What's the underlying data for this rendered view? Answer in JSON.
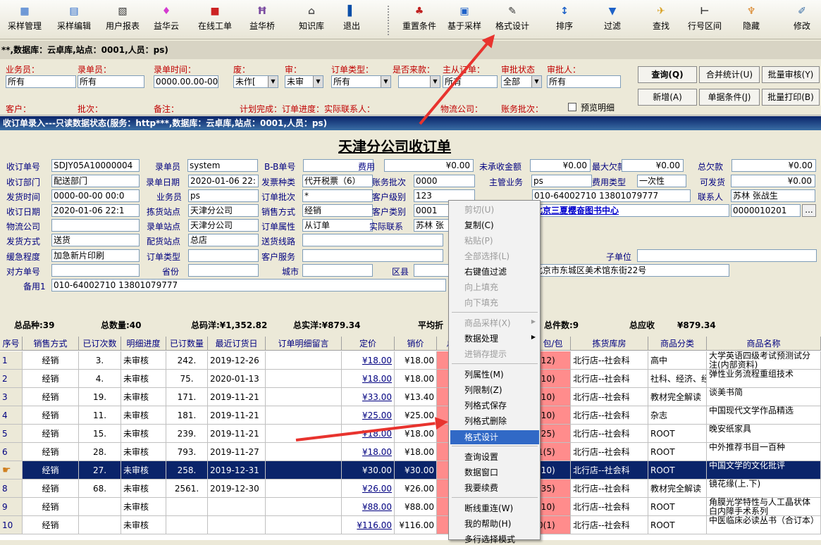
{
  "toolbar": [
    {
      "label": "采样管理",
      "icon": "grid-icon",
      "color": "#1e62c8"
    },
    {
      "label": "采样编辑",
      "icon": "grid-edit-icon",
      "color": "#1e62c8"
    },
    {
      "label": "用户报表",
      "icon": "report-icon",
      "color": "#333333"
    },
    {
      "label": "益华云",
      "icon": "cloud-app-icon",
      "color": "#d43bd0"
    },
    {
      "label": "在线工单",
      "icon": "online-ticket-icon",
      "color": "#cc2222"
    },
    {
      "label": "益华桥",
      "icon": "bridge-icon",
      "color": "#7a4aa0"
    },
    {
      "label": "知识库",
      "icon": "library-icon",
      "color": "#555555"
    },
    {
      "label": "退出",
      "icon": "exit-icon",
      "color": "#0a4ea8"
    },
    {
      "label": "重置条件",
      "icon": "reset-icon",
      "color": "#c02020"
    },
    {
      "label": "基于采样",
      "icon": "sample-icon",
      "color": "#1e62c8"
    },
    {
      "label": "格式设计",
      "icon": "format-design-icon",
      "color": "#333333"
    },
    {
      "label": "排序",
      "icon": "sort-icon",
      "color": "#1e62c8"
    },
    {
      "label": "过滤",
      "icon": "filter-icon",
      "color": "#1e62c8"
    },
    {
      "label": "查找",
      "icon": "find-icon",
      "color": "#d8a020"
    },
    {
      "label": "行号区间",
      "icon": "row-range-icon",
      "color": "#333333"
    },
    {
      "label": "隐藏",
      "icon": "hide-icon",
      "color": "#d88020"
    },
    {
      "label": "修改",
      "icon": "edit-icon",
      "color": "#3a6ea5"
    }
  ],
  "infobar": "**,数据库：云卓库,站点：0001,人员：ps)",
  "query": {
    "labels": [
      "业务员：",
      "录单员：",
      "录单时间：",
      "废：",
      "审：",
      "订单类型：",
      "是否来款：",
      "主从订单：",
      "审批状态",
      "审批人："
    ],
    "labels2": [
      "客户：",
      "批次：",
      "备注：",
      "计划完成：订单进度：实际联系人：",
      "物流公司：",
      "账务批次：",
      "预览明细"
    ],
    "inputs": {
      "salesman": "所有",
      "clerk": "所有",
      "time": "0000.00.00-00",
      "void": "未作[",
      "audit": "未审",
      "order_type": "所有",
      "has_payment": "",
      "master_slave": "所有",
      "approval": "全部",
      "approver": "所有"
    },
    "buttons": [
      "查询(Q)",
      "合并统计(U)",
      "批量审核(Y)",
      "新增(A)",
      "单据条件(J)",
      "批量打印(B)"
    ]
  },
  "form_title": "收订单录入---只读数据状态(服务：http***,数据库：云卓库,站点：0001,人员：ps)",
  "form": {
    "heading": "天津分公司收订单",
    "fields": [
      {
        "label": "收订单号",
        "value": "SDJY05A10000004"
      },
      {
        "label": "录单员",
        "value": "system"
      },
      {
        "label": "B-B单号",
        "value": ""
      },
      {
        "label": "费用",
        "value": "¥0.00"
      },
      {
        "label": "未承收金额",
        "value": "¥0.00"
      },
      {
        "label": "最大欠款",
        "value": "¥0.00"
      },
      {
        "label": "总欠款",
        "value": "¥0.00"
      },
      {
        "label": "收订部门",
        "value": "配送部门"
      },
      {
        "label": "录单日期",
        "value": "2020-01-06 22:"
      },
      {
        "label": "发票种类",
        "value": "代开税票（6）"
      },
      {
        "label": "账务批次",
        "value": "0000"
      },
      {
        "label": "主管业务",
        "value": "ps"
      },
      {
        "label": "费用类型",
        "value": "一次性"
      },
      {
        "label": "可发货",
        "value": "¥0.00"
      },
      {
        "label": "发货时间",
        "value": "0000-00-00 00:0"
      },
      {
        "label": "业务员",
        "value": "ps"
      },
      {
        "label": "订单批次",
        "value": "*"
      },
      {
        "label": "客户级别",
        "value": "123"
      },
      {
        "label": "电话",
        "value": "010-64002710  13801079777"
      },
      {
        "label": "联系人",
        "value": "苏林  张战生"
      },
      {
        "label": "收订日期",
        "value": "2020-01-06 22:1"
      },
      {
        "label": "拣货站点",
        "value": "天津分公司"
      },
      {
        "label": "销售方式",
        "value": "经销"
      },
      {
        "label": "客户类别",
        "value": "0001"
      },
      {
        "label": "客户",
        "value": "北京三夏樱奋图书中心"
      },
      {
        "label": "客户编号",
        "value": "0000010201"
      },
      {
        "label": "物流公司",
        "value": ""
      },
      {
        "label": "录单站点",
        "value": "天津分公司"
      },
      {
        "label": "订单属性",
        "value": "从订单"
      },
      {
        "label": "实际联系",
        "value": "苏林  张"
      },
      {
        "label": "发货方式",
        "value": "送货"
      },
      {
        "label": "配货站点",
        "value": "总店"
      },
      {
        "label": "送货线路",
        "value": ""
      },
      {
        "label": "缓急程度",
        "value": "加急新片印刷"
      },
      {
        "label": "订单类型",
        "value": ""
      },
      {
        "label": "客户服务",
        "value": ""
      },
      {
        "label": "子单位",
        "value": ""
      },
      {
        "label": "对方单号",
        "value": ""
      },
      {
        "label": "省份",
        "value": ""
      },
      {
        "label": "城市",
        "value": ""
      },
      {
        "label": "区县",
        "value": ""
      },
      {
        "label": "地址",
        "value": "北京市东城区美术馆东街22号"
      },
      {
        "label": "备用1",
        "value": "010-64002710  13801079777"
      }
    ]
  },
  "summary": {
    "kinds": "总品种:39",
    "qty": "总数量:40",
    "list_price": "总码洋:¥1,352.82",
    "actual_price": "总实洋:¥879.34",
    "avg_discount": "平均折",
    "packages": "总件数:9",
    "receivable": "总应收",
    "receivable_value": "¥879.34"
  },
  "grid": {
    "headers": [
      "序号",
      "销售方式",
      "已订次数",
      "明细进度",
      "已订数量",
      "最近订货日",
      "订单明细留言",
      "定价",
      "销价",
      "总",
      "包/包",
      "拣货库房",
      "商品分类",
      "商品名称"
    ],
    "rows": [
      {
        "no": "1",
        "method": "经销",
        "times": "3.",
        "progress": "未审核",
        "qty": "242.",
        "date": "2019-12-26",
        "note": "",
        "price": "¥18.00",
        "sale": "¥18.00",
        "pkg": "(12)",
        "store": "北行店--社会科",
        "cat": "高中",
        "name": "大学英语四级考试预测试分注(内部资料)"
      },
      {
        "no": "2",
        "method": "经销",
        "times": "4.",
        "progress": "未审核",
        "qty": "75.",
        "date": "2020-01-13",
        "note": "",
        "price": "¥18.00",
        "sale": "¥18.00",
        "pkg": "(10)",
        "store": "北行店--社会科",
        "cat": "社科、经济、经",
        "name": "弹性业务流程重组技术"
      },
      {
        "no": "3",
        "method": "经销",
        "times": "19.",
        "progress": "未审核",
        "qty": "171.",
        "date": "2019-11-21",
        "note": "",
        "price": "¥33.00",
        "sale": "¥13.40",
        "pkg": "(10)",
        "store": "北行店--社会科",
        "cat": "教材完全解读",
        "name": "谈美书简"
      },
      {
        "no": "4",
        "method": "经销",
        "times": "11.",
        "progress": "未审核",
        "qty": "181.",
        "date": "2019-11-21",
        "note": "",
        "price": "¥25.00",
        "sale": "¥25.00",
        "pkg": "(10)",
        "store": "北行店--社会科",
        "cat": "杂志",
        "name": "中国现代文学作品精选"
      },
      {
        "no": "5",
        "method": "经销",
        "times": "15.",
        "progress": "未审核",
        "qty": "239.",
        "date": "2019-11-21",
        "note": "",
        "price": "¥18.00",
        "sale": "¥18.00",
        "pkg": "(25)",
        "store": "北行店--社会科",
        "cat": "ROOT",
        "name": "晚安纸家具"
      },
      {
        "no": "6",
        "method": "经销",
        "times": "28.",
        "progress": "未审核",
        "qty": "793.",
        "date": "2019-11-27",
        "note": "",
        "price": "¥18.00",
        "sale": "¥18.00",
        "pkg": "1(5)",
        "store": "北行店--社会科",
        "cat": "ROOT",
        "name": "中外推荐书目一百种"
      },
      {
        "no": "7",
        "method": "经销",
        "times": "27.",
        "progress": "未审核",
        "qty": "258.",
        "date": "2019-12-31",
        "note": "",
        "price": "¥30.00",
        "sale": "¥30.00",
        "pkg": "(10)",
        "store": "北行店--社会科",
        "cat": "ROOT",
        "name": "中国文学的文化批评"
      },
      {
        "no": "8",
        "method": "经销",
        "times": "68.",
        "progress": "未审核",
        "qty": "2561.",
        "date": "2019-12-30",
        "note": "",
        "price": "¥26.00",
        "sale": "¥26.00",
        "pkg": "(35)",
        "store": "北行店--社会科",
        "cat": "教材完全解读",
        "name": "镜花缘(上.下)"
      },
      {
        "no": "9",
        "method": "经销",
        "times": "",
        "progress": "未审核",
        "qty": "",
        "date": "",
        "note": "",
        "price": "¥88.00",
        "sale": "¥88.00",
        "pkg": "(10)",
        "store": "北行店--社会科",
        "cat": "ROOT",
        "name": "角膜光学特性与人工晶状体白内障手术系列"
      },
      {
        "no": "10",
        "method": "经销",
        "times": "",
        "progress": "未审核",
        "qty": "",
        "date": "",
        "note": "",
        "price": "¥116.00",
        "sale": "¥116.00",
        "pkg": "0(1)",
        "store": "北行店--社会科",
        "cat": "ROOT",
        "name": "中医临床必读丛书（合订本）"
      }
    ]
  },
  "context_menu": [
    {
      "label": "剪切(U)",
      "disabled": true
    },
    {
      "label": "复制(C)",
      "disabled": false
    },
    {
      "label": "粘贴(P)",
      "disabled": true
    },
    {
      "label": "全部选择(L)",
      "disabled": true
    },
    {
      "label": "右键值过滤",
      "disabled": false
    },
    {
      "label": "向上填充",
      "disabled": true
    },
    {
      "label": "向下填充",
      "disabled": true
    },
    {
      "label": "商品采样(X)",
      "disabled": true,
      "submenu": true
    },
    {
      "label": "数据处理",
      "disabled": false,
      "submenu": true
    },
    {
      "label": "进销存提示",
      "disabled": true
    },
    {
      "label": "列属性(M)",
      "disabled": false
    },
    {
      "label": "列限制(Z)",
      "disabled": false
    },
    {
      "label": "列格式保存",
      "disabled": false
    },
    {
      "label": "列格式删除",
      "disabled": false
    },
    {
      "label": "格式设计",
      "disabled": false,
      "highlight": true
    },
    {
      "label": "查询设置",
      "disabled": false
    },
    {
      "label": "数据窗口",
      "disabled": false
    },
    {
      "label": "我要续费",
      "disabled": false
    },
    {
      "label": "断线重连(W)",
      "disabled": false
    },
    {
      "label": "我的帮助(H)",
      "disabled": false
    },
    {
      "label": "多行选择模式",
      "disabled": false
    }
  ],
  "colors": {
    "label": "#000080",
    "query_label": "#c00000",
    "selected_row": "#0a246a",
    "highlight": "#3169c6",
    "arrow": "#e8332e",
    "pink": "#ff8c8c"
  }
}
